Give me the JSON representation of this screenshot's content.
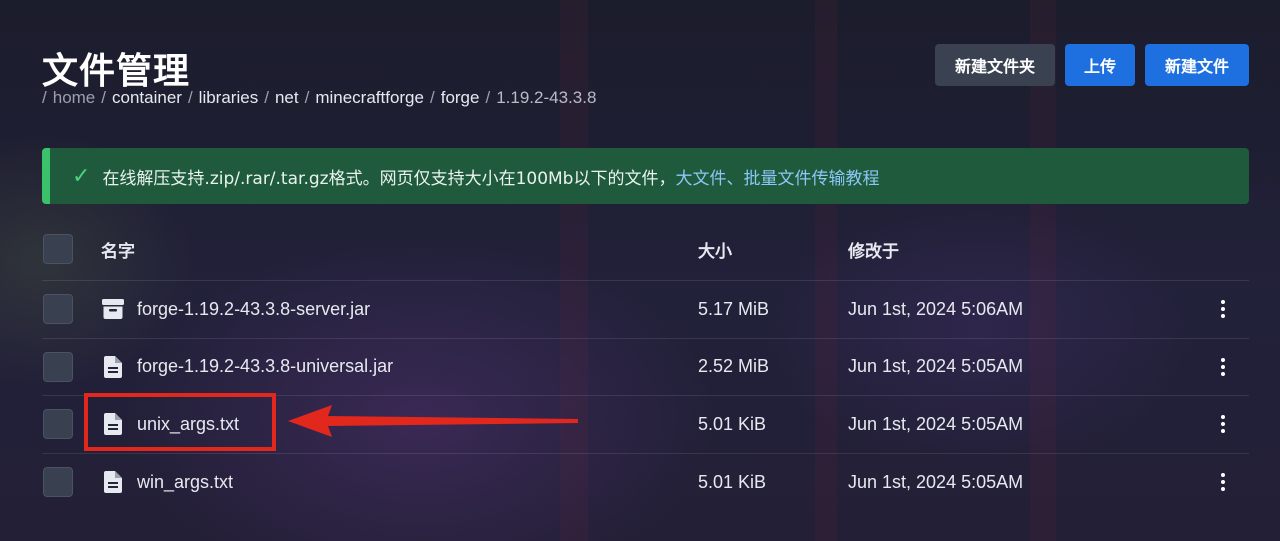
{
  "page": {
    "title": "文件管理"
  },
  "breadcrumb": [
    "home",
    "container",
    "libraries",
    "net",
    "minecraftforge",
    "forge",
    "1.19.2-43.3.8"
  ],
  "toolbar": {
    "new_folder_label": "新建文件夹",
    "upload_label": "上传",
    "new_file_label": "新建文件"
  },
  "alert": {
    "text": "在线解压支持.zip/.rar/.tar.gz格式。网页仅支持大小在100Mb以下的文件，",
    "link_text": "大文件、批量文件传输教程",
    "icon": "check-icon"
  },
  "table": {
    "headers": {
      "name": "名字",
      "size": "大小",
      "modified": "修改于"
    },
    "rows": [
      {
        "name": "forge-1.19.2-43.3.8-server.jar",
        "size": "5.17 MiB",
        "modified": "Jun 1st, 2024 5:06AM",
        "icon": "archive-icon"
      },
      {
        "name": "forge-1.19.2-43.3.8-universal.jar",
        "size": "2.52 MiB",
        "modified": "Jun 1st, 2024 5:05AM",
        "icon": "file-icon"
      },
      {
        "name": "unix_args.txt",
        "size": "5.01 KiB",
        "modified": "Jun 1st, 2024 5:05AM",
        "icon": "file-icon"
      },
      {
        "name": "win_args.txt",
        "size": "5.01 KiB",
        "modified": "Jun 1st, 2024 5:05AM",
        "icon": "file-icon"
      }
    ]
  },
  "colors": {
    "accent_blue": "#1e6fe0",
    "alert_green": "#1f5a3d",
    "annotation_red": "#e2271d"
  }
}
